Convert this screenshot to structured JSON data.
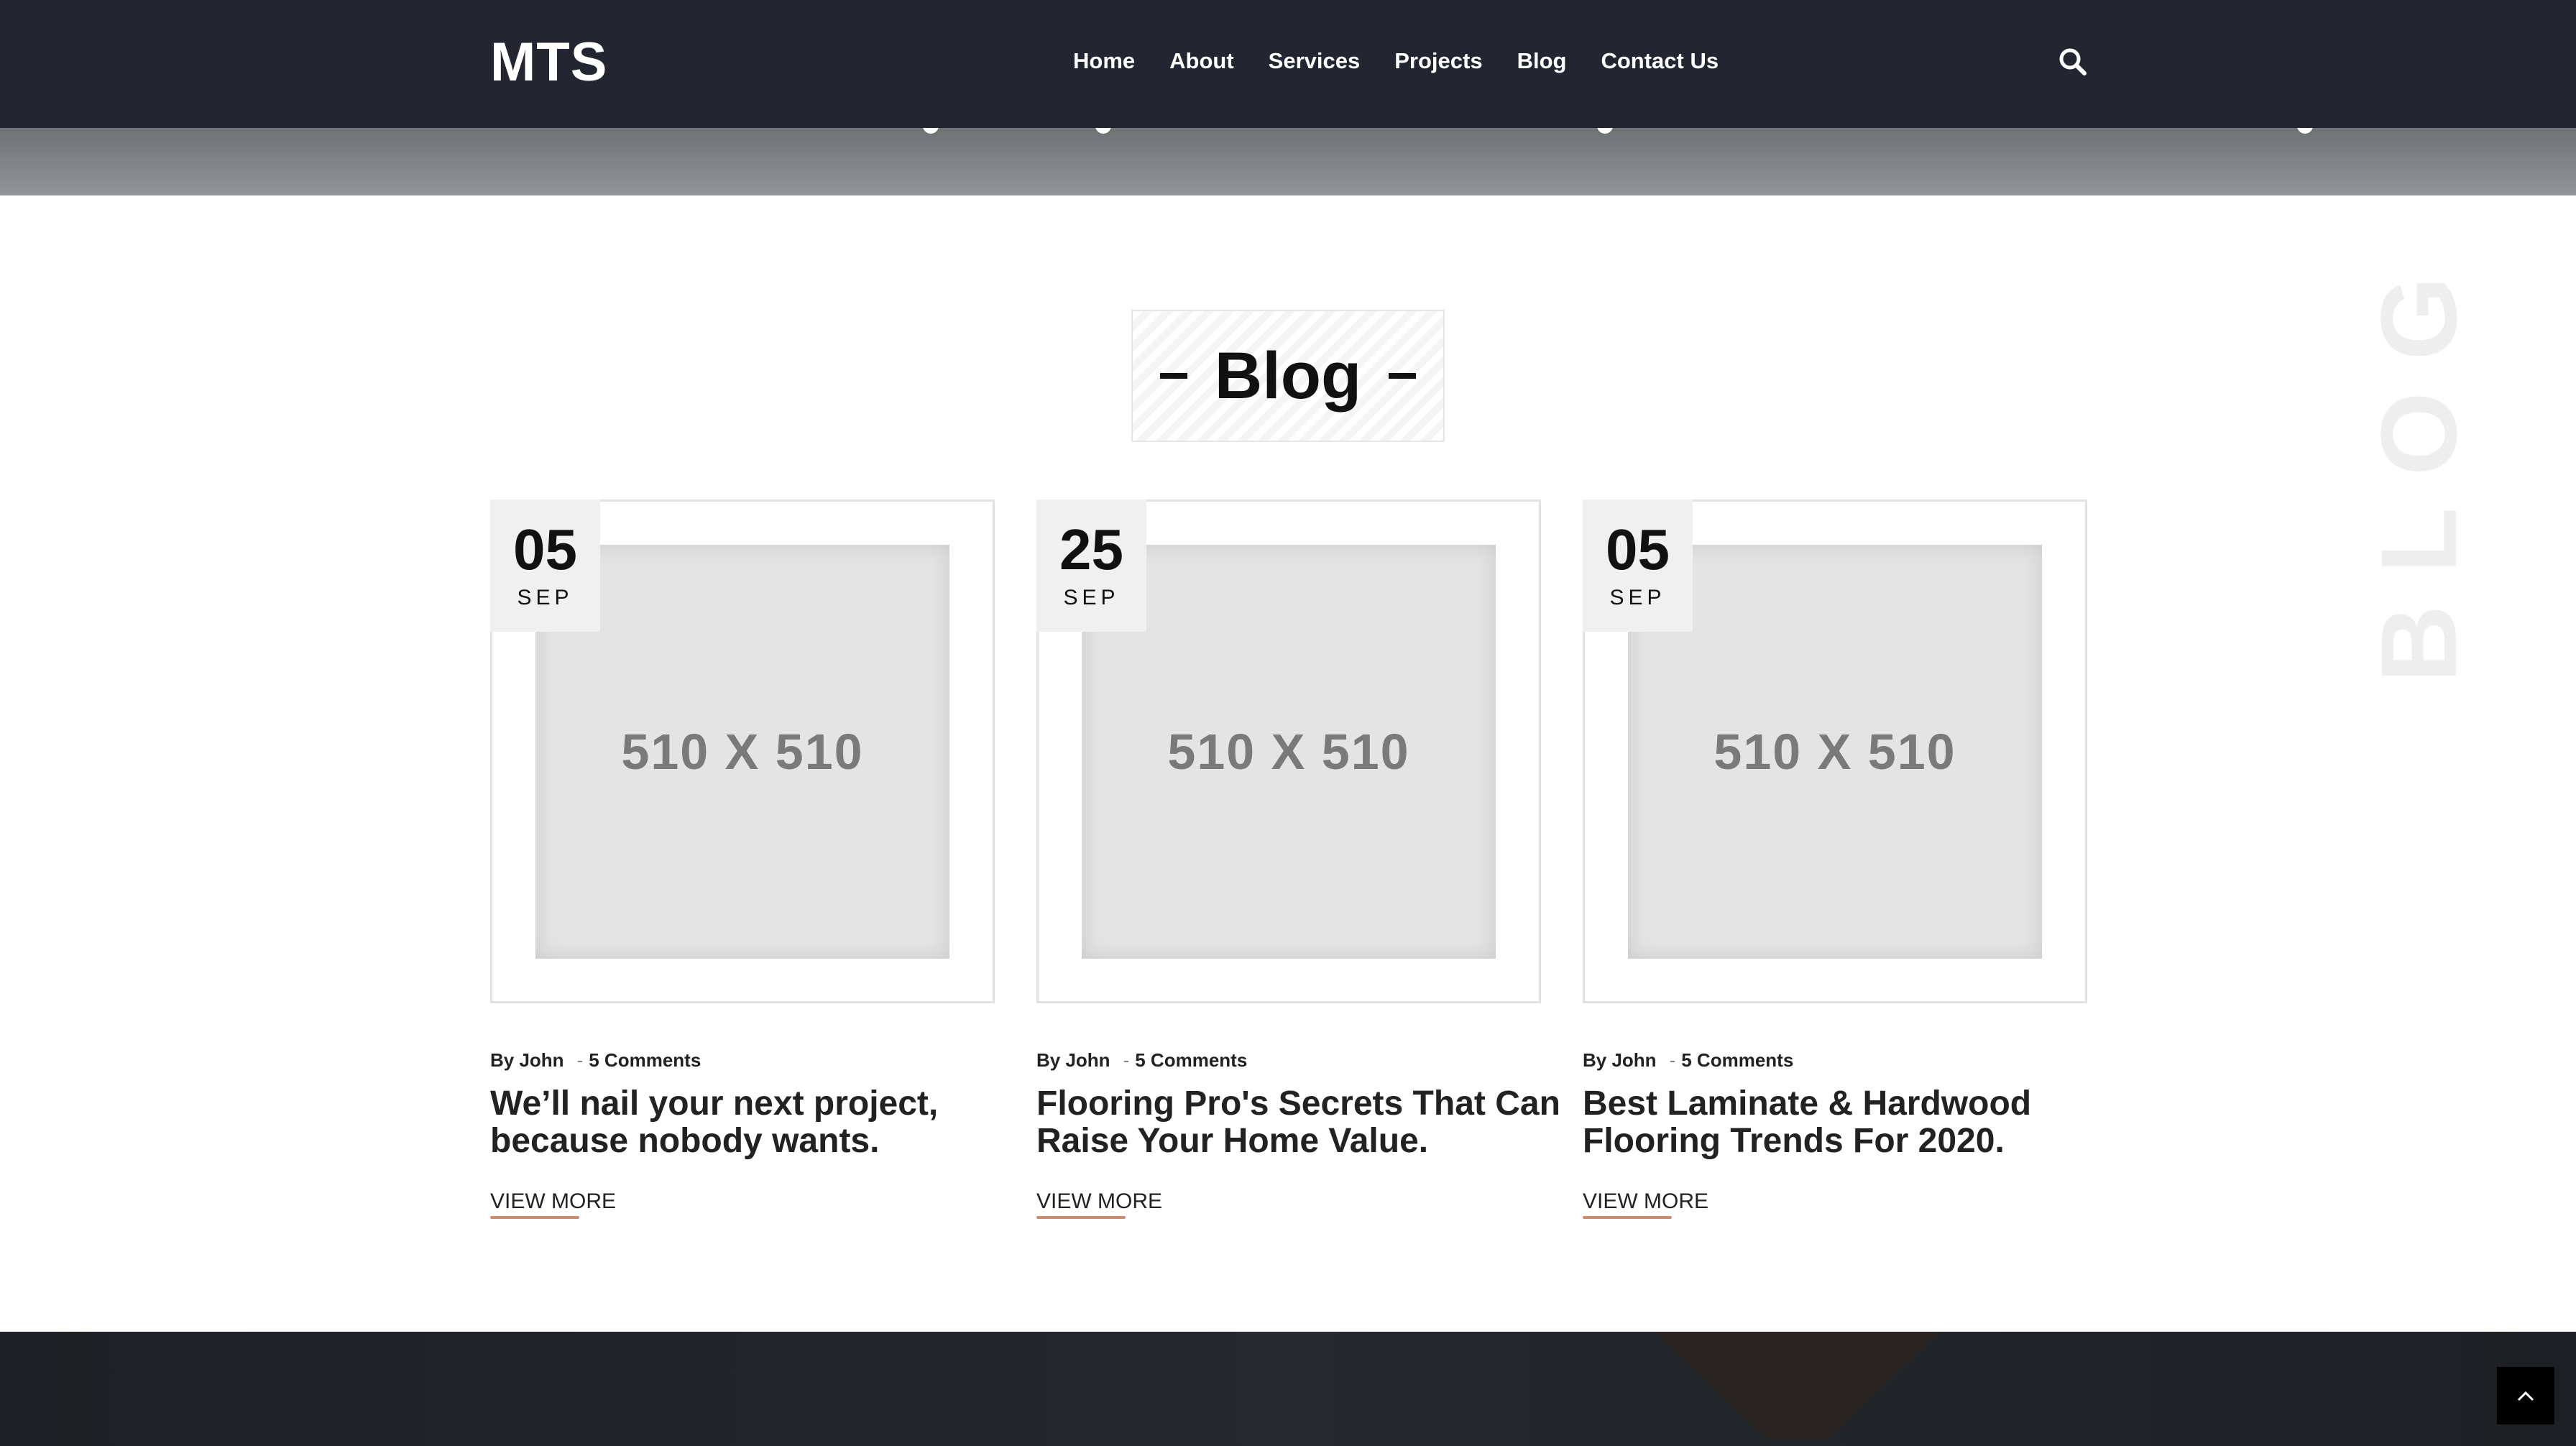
{
  "header": {
    "logo": "MTS",
    "nav": [
      "Home",
      "About",
      "Services",
      "Projects",
      "Blog",
      "Contact Us"
    ],
    "search_icon": "search-icon"
  },
  "section": {
    "heading": "Blog",
    "watermark": "BLOG"
  },
  "posts": [
    {
      "day": "05",
      "month": "SEP",
      "image_label": "510 X 510",
      "author": "By John",
      "comments": "5 Comments",
      "title": "We’ll nail your next project, because nobody wants.",
      "cta": "VIEW MORE"
    },
    {
      "day": "25",
      "month": "SEP",
      "image_label": "510 X 510",
      "author": "By John",
      "comments": "5 Comments",
      "title": "Flooring Pro's Secrets That Can Raise Your Home Value.",
      "cta": "VIEW MORE"
    },
    {
      "day": "05",
      "month": "SEP",
      "image_label": "510 X 510",
      "author": "By John",
      "comments": "5 Comments",
      "title": "Best Laminate & Hardwood Flooring Trends For 2020.",
      "cta": "VIEW MORE"
    }
  ],
  "colors": {
    "header_bg": "#232630",
    "accent_underline": "#c98b73",
    "footer_bg": "#1d2024"
  },
  "scroll_top_icon": "chevron-up-icon"
}
